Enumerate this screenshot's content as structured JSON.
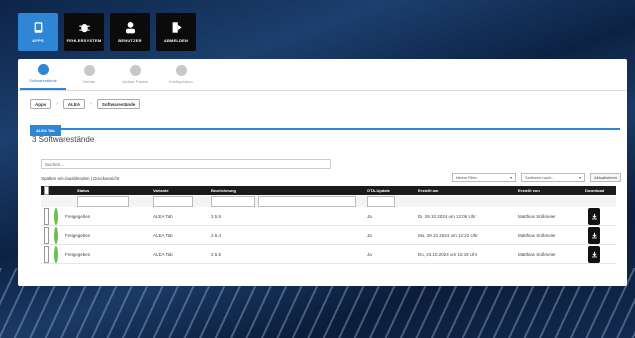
{
  "nav": [
    {
      "label": "APPS",
      "icon": "apps-icon",
      "active": true
    },
    {
      "label": "FEHLERSYSTEM",
      "icon": "bug-icon",
      "active": false
    },
    {
      "label": "BENUTZER",
      "icon": "user-icon",
      "active": false
    },
    {
      "label": "ABMELDEN",
      "icon": "logout-icon",
      "active": false
    }
  ],
  "subtabs": [
    {
      "label": "Softwarestände",
      "active": true
    },
    {
      "label": "Geräte",
      "active": false
    },
    {
      "label": "Update Pakete",
      "active": false
    },
    {
      "label": "Konfiguration",
      "active": false
    }
  ],
  "breadcrumb": [
    "Apps",
    "ALEA",
    "Softwarestände"
  ],
  "tab_label": "ALEA Tab",
  "page_title": "3 Softwarestände",
  "search_placeholder": "Suchen...",
  "columns_link": "Spalten ein-/ausblenden | Druckansicht",
  "filter_select": "Meine Filter",
  "sort_select": "Sortieren nach...",
  "refresh_button": "Aktualisieren",
  "headers": [
    "Status",
    "Variante",
    "Bezeichnung",
    "OTA-Update",
    "Erstellt am",
    "Erstellt von",
    "Download"
  ],
  "rows": [
    {
      "status": "Freigegeben",
      "variante": "ALEA Tab",
      "bezeichnung": "2.5.5",
      "ota": "Ja",
      "created": "Di, 29.10.2024 um 12:06 Uhr",
      "author": "Matthias Süßmeier"
    },
    {
      "status": "Freigegeben",
      "variante": "ALEA Tab",
      "bezeichnung": "2.5.4",
      "ota": "Ja",
      "created": "Mo, 28.10.2024 um 12:22 Uhr",
      "author": "Matthias Süßmeier"
    },
    {
      "status": "Freigegeben",
      "variante": "ALEA Tab",
      "bezeichnung": "2.5.5",
      "ota": "Ja",
      "created": "Do, 24.10.2024 um 15:15 Uhr",
      "author": "Matthias Süßmeier"
    }
  ],
  "colors": {
    "accent": "#2f86d6",
    "status_green": "#6cc04a",
    "header_dark": "#1b1b1b"
  }
}
